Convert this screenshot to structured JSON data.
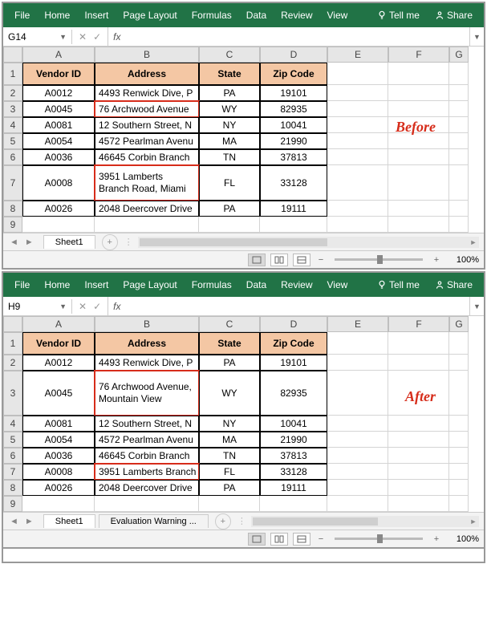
{
  "ribbon": {
    "tabs": [
      "File",
      "Home",
      "Insert",
      "Page Layout",
      "Formulas",
      "Data",
      "Review",
      "View"
    ],
    "tellme": "Tell me",
    "share": "Share"
  },
  "panels": {
    "before": {
      "namebox": "G14",
      "anno": "Before",
      "rows": [
        {
          "n": "2",
          "id": "A0012",
          "addr": "4493 Renwick Dive, P",
          "st": "PA",
          "zip": "19101",
          "wrap": false,
          "red": false,
          "tall": false
        },
        {
          "n": "3",
          "id": "A0045",
          "addr": "76 Archwood Avenue",
          "st": "WY",
          "zip": "82935",
          "wrap": false,
          "red": true,
          "tall": false
        },
        {
          "n": "4",
          "id": "A0081",
          "addr": "12 Southern Street, N",
          "st": "NY",
          "zip": "10041",
          "wrap": false,
          "red": false,
          "tall": false
        },
        {
          "n": "5",
          "id": "A0054",
          "addr": "4572 Pearlman Avenu",
          "st": "MA",
          "zip": "21990",
          "wrap": false,
          "red": false,
          "tall": false
        },
        {
          "n": "6",
          "id": "A0036",
          "addr": "46645 Corbin Branch",
          "st": "TN",
          "zip": "37813",
          "wrap": false,
          "red": false,
          "tall": false
        },
        {
          "n": "7",
          "id": "A0008",
          "addr": "3951 Lamberts Branch Road, Miami",
          "st": "FL",
          "zip": "33128",
          "wrap": true,
          "red": true,
          "tall": true
        },
        {
          "n": "8",
          "id": "A0026",
          "addr": "2048 Deercover Drive",
          "st": "PA",
          "zip": "19111",
          "wrap": false,
          "red": false,
          "tall": false
        },
        {
          "n": "9",
          "id": "",
          "addr": "",
          "st": "",
          "zip": "",
          "wrap": false,
          "red": false,
          "tall": false,
          "empty": true
        }
      ],
      "sheets": [
        {
          "name": "Sheet1"
        }
      ],
      "extrasheet": null
    },
    "after": {
      "namebox": "H9",
      "anno": "After",
      "rows": [
        {
          "n": "2",
          "id": "A0012",
          "addr": "4493 Renwick Dive, P",
          "st": "PA",
          "zip": "19101",
          "wrap": false,
          "red": false,
          "tall": false
        },
        {
          "n": "3",
          "id": "A0045",
          "addr": "76 Archwood Avenue, Mountain View",
          "st": "WY",
          "zip": "82935",
          "wrap": true,
          "red": true,
          "tall": true
        },
        {
          "n": "4",
          "id": "A0081",
          "addr": "12 Southern Street, N",
          "st": "NY",
          "zip": "10041",
          "wrap": false,
          "red": false,
          "tall": false
        },
        {
          "n": "5",
          "id": "A0054",
          "addr": "4572 Pearlman Avenu",
          "st": "MA",
          "zip": "21990",
          "wrap": false,
          "red": false,
          "tall": false
        },
        {
          "n": "6",
          "id": "A0036",
          "addr": "46645 Corbin Branch",
          "st": "TN",
          "zip": "37813",
          "wrap": false,
          "red": false,
          "tall": false
        },
        {
          "n": "7",
          "id": "A0008",
          "addr": "3951 Lamberts Branch",
          "st": "FL",
          "zip": "33128",
          "wrap": false,
          "red": true,
          "tall": false
        },
        {
          "n": "8",
          "id": "A0026",
          "addr": "2048 Deercover Drive",
          "st": "PA",
          "zip": "19111",
          "wrap": false,
          "red": false,
          "tall": false
        },
        {
          "n": "9",
          "id": "",
          "addr": "",
          "st": "",
          "zip": "",
          "wrap": false,
          "red": false,
          "tall": false,
          "empty": true
        }
      ],
      "sheets": [
        {
          "name": "Sheet1"
        }
      ],
      "extrasheet": "Evaluation Warning  ..."
    }
  },
  "headers": {
    "a": "Vendor ID",
    "b": "Address",
    "c": "State",
    "d": "Zip Code"
  },
  "cols": [
    "A",
    "B",
    "C",
    "D",
    "E",
    "F",
    "G"
  ],
  "zoom": "100%"
}
